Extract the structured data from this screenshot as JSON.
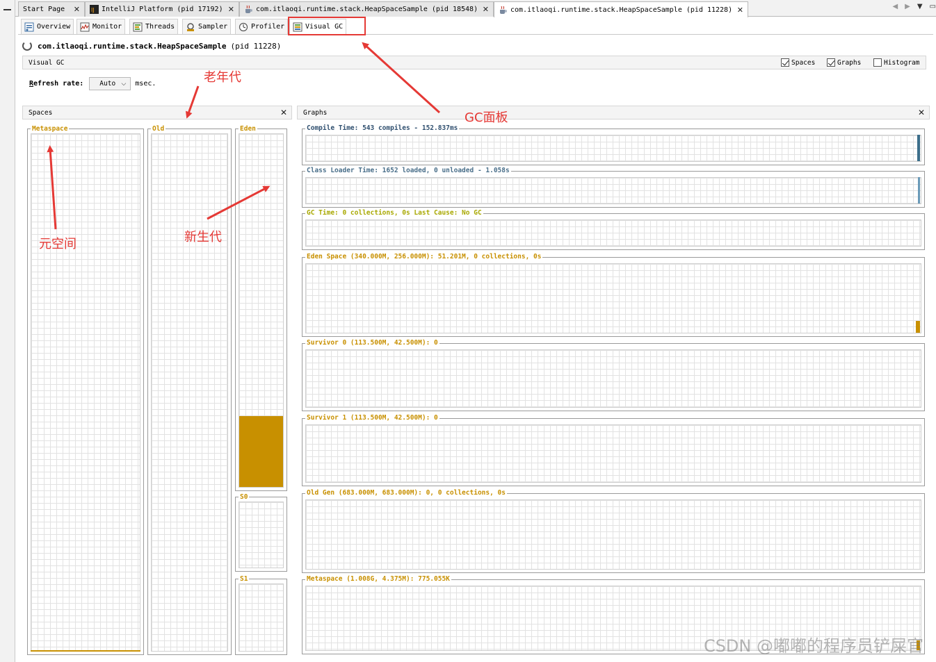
{
  "doc_tabs": [
    {
      "label": "Start Page",
      "icon": "start-page-icon"
    },
    {
      "label": "IntelliJ Platform (pid 17192)",
      "icon": "intellij-icon"
    },
    {
      "label": "com.itlaoqi.runtime.stack.HeapSpaceSample (pid 18548)",
      "icon": "java-cup-icon"
    },
    {
      "label": "com.itlaoqi.runtime.stack.HeapSpaceSample (pid 11228)",
      "icon": "java-cup-icon",
      "active": true
    }
  ],
  "sub_tabs": [
    {
      "label": "Overview",
      "icon": "overview-icon"
    },
    {
      "label": "Monitor",
      "icon": "monitor-icon"
    },
    {
      "label": "Threads",
      "icon": "threads-icon"
    },
    {
      "label": "Sampler",
      "icon": "sampler-icon"
    },
    {
      "label": "Profiler",
      "icon": "profiler-icon"
    },
    {
      "label": "Visual GC",
      "icon": "visual-gc-icon",
      "active": true
    }
  ],
  "app": {
    "class_name": "com.itlaoqi.runtime.stack.HeapSpaceSample",
    "pid": "(pid 11228)"
  },
  "vgc_bar": {
    "title": "Visual GC",
    "checks": [
      {
        "label": "Spaces",
        "checked": true
      },
      {
        "label": "Graphs",
        "checked": true
      },
      {
        "label": "Histogram",
        "checked": false
      }
    ]
  },
  "refresh": {
    "label_first": "R",
    "label_rest": "efresh rate:",
    "value": "Auto",
    "unit": "msec."
  },
  "spaces": {
    "title": "Spaces",
    "metaspace": "Metaspace",
    "old": "Old",
    "eden": "Eden",
    "s0": "S0",
    "s1": "S1",
    "eden_fill": 0.2
  },
  "graphs": {
    "title": "Graphs",
    "items": [
      {
        "label": "Compile Time: 543 compiles - 152.837ms",
        "color": "#2f4f6f"
      },
      {
        "label": "Class Loader Time: 1652 loaded, 0 unloaded - 1.058s",
        "color": "#4a6f8a"
      },
      {
        "label": "GC Time: 0 collections, 0s Last Cause: No GC",
        "color": "#a8a800"
      },
      {
        "label": "Eden Space (340.000M, 256.000M): 51.201M, 0 collections, 0s",
        "color": "#c89000"
      },
      {
        "label": "Survivor 0 (113.500M, 42.500M): 0",
        "color": "#c89000"
      },
      {
        "label": "Survivor 1 (113.500M, 42.500M): 0",
        "color": "#c89000"
      },
      {
        "label": "Old Gen (683.000M, 683.000M): 0, 0 collections, 0s",
        "color": "#c89000"
      },
      {
        "label": "Metaspace (1.008G, 4.375M): 775.055K",
        "color": "#c89000"
      }
    ]
  },
  "annotations": {
    "old_gen": "老年代",
    "gc_panel": "GC面板",
    "young_gen": "新生代",
    "metaspace": "元空间"
  },
  "watermark": "CSDN @嘟嘟的程序员铲屎官",
  "colors": {
    "annotation": "#e53935",
    "space_fill": "#c89000",
    "graph_blue": "#3c6e8a"
  }
}
